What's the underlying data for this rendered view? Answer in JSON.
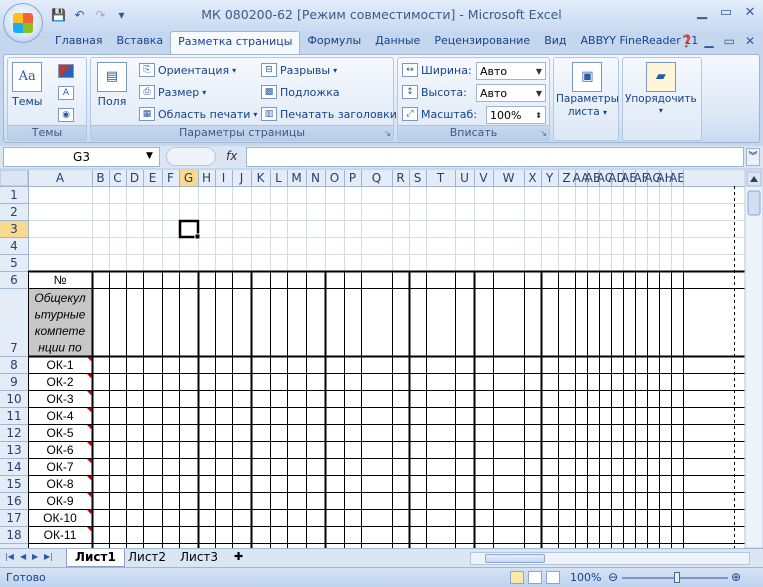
{
  "title": "МК 080200-62  [Режим совместимости] - Microsoft Excel",
  "tabs": [
    "Главная",
    "Вставка",
    "Разметка страницы",
    "Формулы",
    "Данные",
    "Рецензирование",
    "Вид",
    "ABBYY FineReader 11"
  ],
  "active_tab": "Разметка страницы",
  "ribbon": {
    "themes": {
      "button": "Темы",
      "group": "Темы"
    },
    "page_setup": {
      "margins": "Поля",
      "orientation": "Ориентация",
      "size": "Размер",
      "print_area": "Область печати",
      "breaks": "Разрывы",
      "background": "Подложка",
      "print_titles": "Печатать заголовки",
      "group": "Параметры страницы"
    },
    "fit": {
      "width_label": "Ширина:",
      "width_value": "Авто",
      "height_label": "Высота:",
      "height_value": "Авто",
      "scale_label": "Масштаб:",
      "scale_value": "100%",
      "group": "Вписать"
    },
    "sheet_options": {
      "label1": "Параметры",
      "label2": "листа"
    },
    "arrange": {
      "label": "Упорядочить"
    }
  },
  "formula_bar": {
    "name_box": "G3",
    "fx": "fx",
    "formula": ""
  },
  "grid": {
    "columns": [
      "A",
      "B",
      "C",
      "D",
      "E",
      "F",
      "G",
      "H",
      "I",
      "J",
      "K",
      "L",
      "M",
      "N",
      "O",
      "P",
      "Q",
      "R",
      "S",
      "T",
      "U",
      "V",
      "W",
      "X",
      "Y",
      "Z",
      "AA",
      "AB",
      "AC",
      "AD",
      "AE",
      "AF",
      "AG",
      "AH",
      "AE"
    ],
    "rows": [
      "1",
      "2",
      "3",
      "4",
      "5",
      "6",
      "7",
      "8",
      "9",
      "10",
      "11",
      "12",
      "13",
      "14",
      "15",
      "16",
      "17",
      "18"
    ],
    "selected_cell": "G3",
    "header_cell": "№",
    "row7_lines": [
      "Общекул",
      "ьтурные",
      "компете",
      "нции по"
    ],
    "competencies": [
      "ОК-1",
      "ОК-2",
      "ОК-3",
      "ОК-4",
      "ОК-5",
      "ОК-6",
      "ОК-7",
      "ОК-8",
      "ОК-9",
      "ОК-10",
      "ОК-11"
    ]
  },
  "sheet_tabs": [
    "Лист1",
    "Лист2",
    "Лист3"
  ],
  "active_sheet": "Лист1",
  "status": {
    "ready": "Готово",
    "zoom": "100%"
  }
}
